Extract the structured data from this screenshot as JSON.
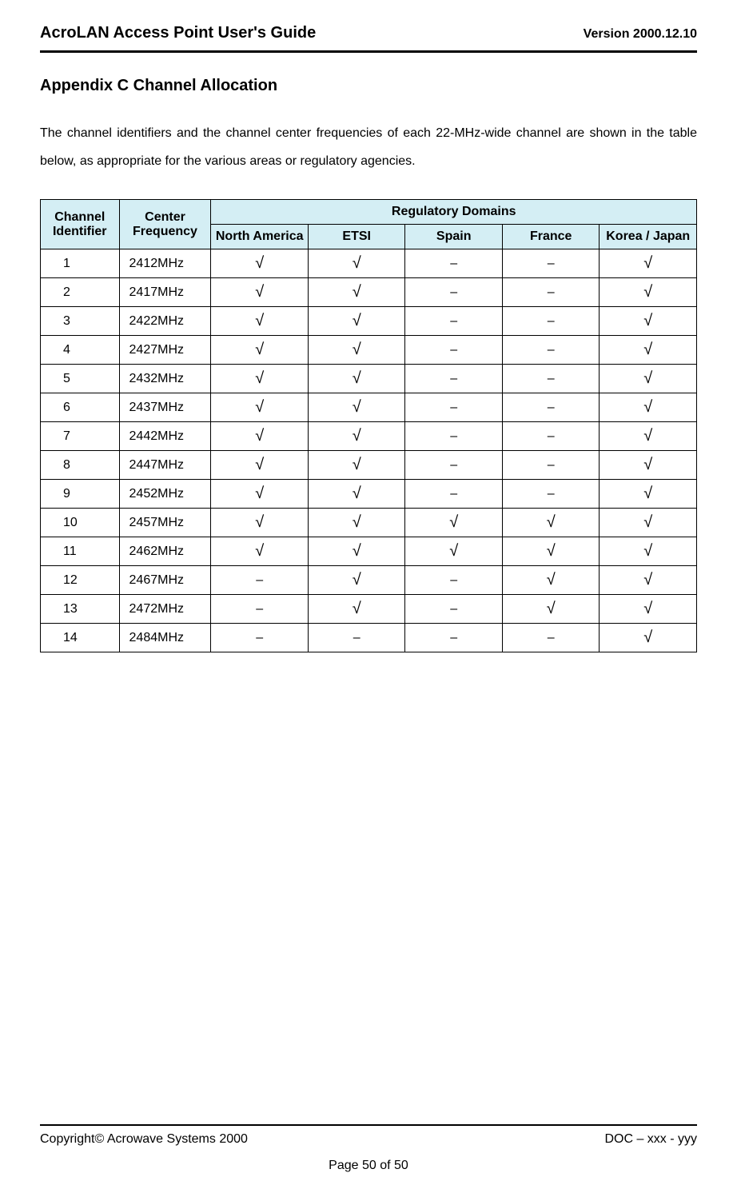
{
  "header": {
    "title": "AcroLAN Access Point User's Guide",
    "version": "Version 2000.12.10"
  },
  "section": {
    "title": "Appendix C   Channel Allocation",
    "intro": "The channel identifiers and the channel center frequencies of each 22-MHz-wide channel are shown in the table below, as appropriate for the various areas or regulatory agencies."
  },
  "table": {
    "headers": {
      "channel": "Channel Identifier",
      "frequency": "Center Frequency",
      "domains": "Regulatory Domains",
      "north_america": "North America",
      "etsi": "ETSI",
      "spain": "Spain",
      "france": "France",
      "korea_japan": "Korea / Japan"
    },
    "rows": [
      {
        "id": "1",
        "freq": "2412MHz",
        "na": "√",
        "etsi": "√",
        "spain": "–",
        "france": "–",
        "kj": "√"
      },
      {
        "id": "2",
        "freq": "2417MHz",
        "na": "√",
        "etsi": "√",
        "spain": "–",
        "france": "–",
        "kj": "√"
      },
      {
        "id": "3",
        "freq": "2422MHz",
        "na": "√",
        "etsi": "√",
        "spain": "–",
        "france": "–",
        "kj": "√"
      },
      {
        "id": "4",
        "freq": "2427MHz",
        "na": "√",
        "etsi": "√",
        "spain": "–",
        "france": "–",
        "kj": "√"
      },
      {
        "id": "5",
        "freq": "2432MHz",
        "na": "√",
        "etsi": "√",
        "spain": "–",
        "france": "–",
        "kj": "√"
      },
      {
        "id": "6",
        "freq": "2437MHz",
        "na": "√",
        "etsi": "√",
        "spain": "–",
        "france": "–",
        "kj": "√"
      },
      {
        "id": "7",
        "freq": "2442MHz",
        "na": "√",
        "etsi": "√",
        "spain": "–",
        "france": "–",
        "kj": "√"
      },
      {
        "id": "8",
        "freq": "2447MHz",
        "na": "√",
        "etsi": "√",
        "spain": "–",
        "france": "–",
        "kj": "√"
      },
      {
        "id": "9",
        "freq": "2452MHz",
        "na": "√",
        "etsi": "√",
        "spain": "–",
        "france": "–",
        "kj": "√"
      },
      {
        "id": "10",
        "freq": "2457MHz",
        "na": "√",
        "etsi": "√",
        "spain": "√",
        "france": "√",
        "kj": "√"
      },
      {
        "id": "11",
        "freq": "2462MHz",
        "na": "√",
        "etsi": "√",
        "spain": "√",
        "france": "√",
        "kj": "√"
      },
      {
        "id": "12",
        "freq": "2467MHz",
        "na": "–",
        "etsi": "√",
        "spain": "–",
        "france": "√",
        "kj": "√"
      },
      {
        "id": "13",
        "freq": "2472MHz",
        "na": "–",
        "etsi": "√",
        "spain": "–",
        "france": "√",
        "kj": "√"
      },
      {
        "id": "14",
        "freq": "2484MHz",
        "na": "–",
        "etsi": "–",
        "spain": "–",
        "france": "–",
        "kj": "√"
      }
    ]
  },
  "footer": {
    "copyright": "Copyright© Acrowave Systems 2000",
    "doc": "DOC – xxx - yyy",
    "page": "Page 50 of 50"
  }
}
